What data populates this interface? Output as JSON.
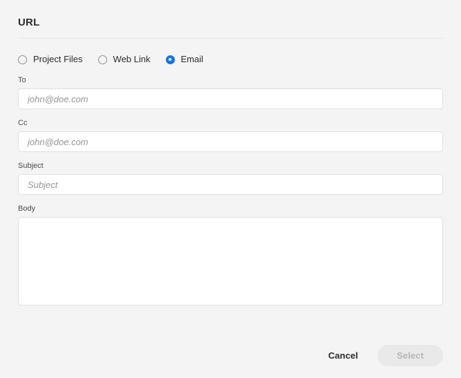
{
  "dialog": {
    "title": "URL"
  },
  "source_type": {
    "selected": "email",
    "accent_color": "#1473e6",
    "options": [
      {
        "id": "project-files",
        "label": "Project Files",
        "selected": false
      },
      {
        "id": "web-link",
        "label": "Web Link",
        "selected": false
      },
      {
        "id": "email",
        "label": "Email",
        "selected": true
      }
    ]
  },
  "form": {
    "to": {
      "label": "To",
      "value": "",
      "placeholder": "john@doe.com"
    },
    "cc": {
      "label": "Cc",
      "value": "",
      "placeholder": "john@doe.com"
    },
    "subject": {
      "label": "Subject",
      "value": "",
      "placeholder": "Subject"
    },
    "body": {
      "label": "Body",
      "value": "",
      "placeholder": ""
    }
  },
  "footer": {
    "cancel_label": "Cancel",
    "select_label": "Select",
    "select_disabled": true
  },
  "colors": {
    "background": "#f4f4f4",
    "field_background": "#ffffff",
    "field_border": "#e0e0e0",
    "divider": "#e4e4e4",
    "text": "#2c2c2c",
    "placeholder": "#959595",
    "accent": "#1473e6",
    "disabled_button_bg": "#e9e9e9",
    "disabled_button_text": "#b6b6b6"
  }
}
